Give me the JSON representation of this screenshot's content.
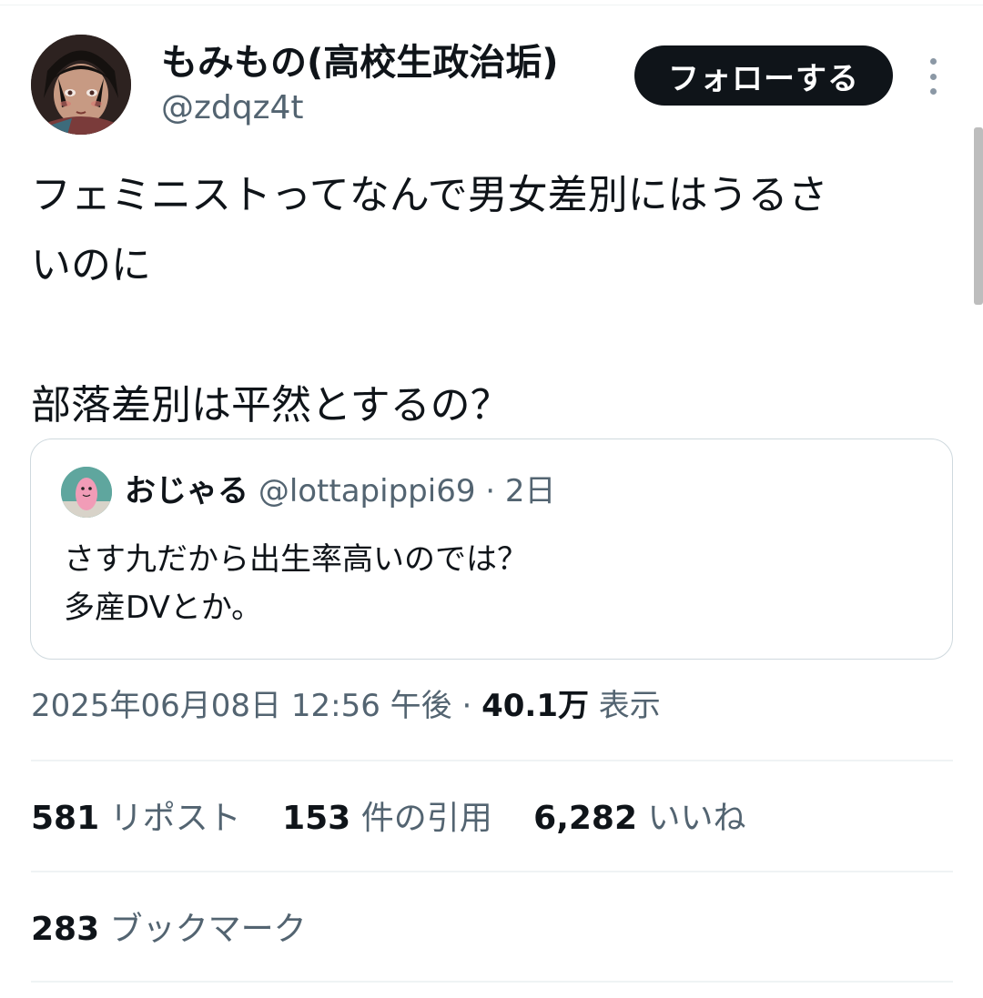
{
  "tweet": {
    "author": {
      "display_name": "もみもの(高校生政治垢)",
      "handle": "@zdqz4t"
    },
    "follow_label": "フォローする",
    "more_icon": "more-vertical-icon",
    "text": "フェミニストってなんで男女差別にはうるさ\nいのに\n\n部落差別は平然とするの？",
    "quote": {
      "display_name": "おじゃる",
      "handle": "@lottapippi69",
      "time": "2日",
      "separator": " · ",
      "text": "さす九だから出生率高いのでは？\n多産DVとか。"
    },
    "timestamp": "2025年06月08日 12:56 午後",
    "meta_separator": " · ",
    "views_count": "40.1万",
    "views_label": "表示",
    "stats": {
      "reposts_count": "581",
      "reposts_label": "リポスト",
      "quotes_count": "153",
      "quotes_label": "件の引用",
      "likes_count": "6,282",
      "likes_label": "いいね",
      "bookmarks_count": "283",
      "bookmarks_label": "ブックマーク"
    }
  },
  "colors": {
    "text_primary": "#0f1419",
    "text_secondary": "#536471",
    "button_bg": "#0f1419",
    "border": "#cfd9de"
  }
}
